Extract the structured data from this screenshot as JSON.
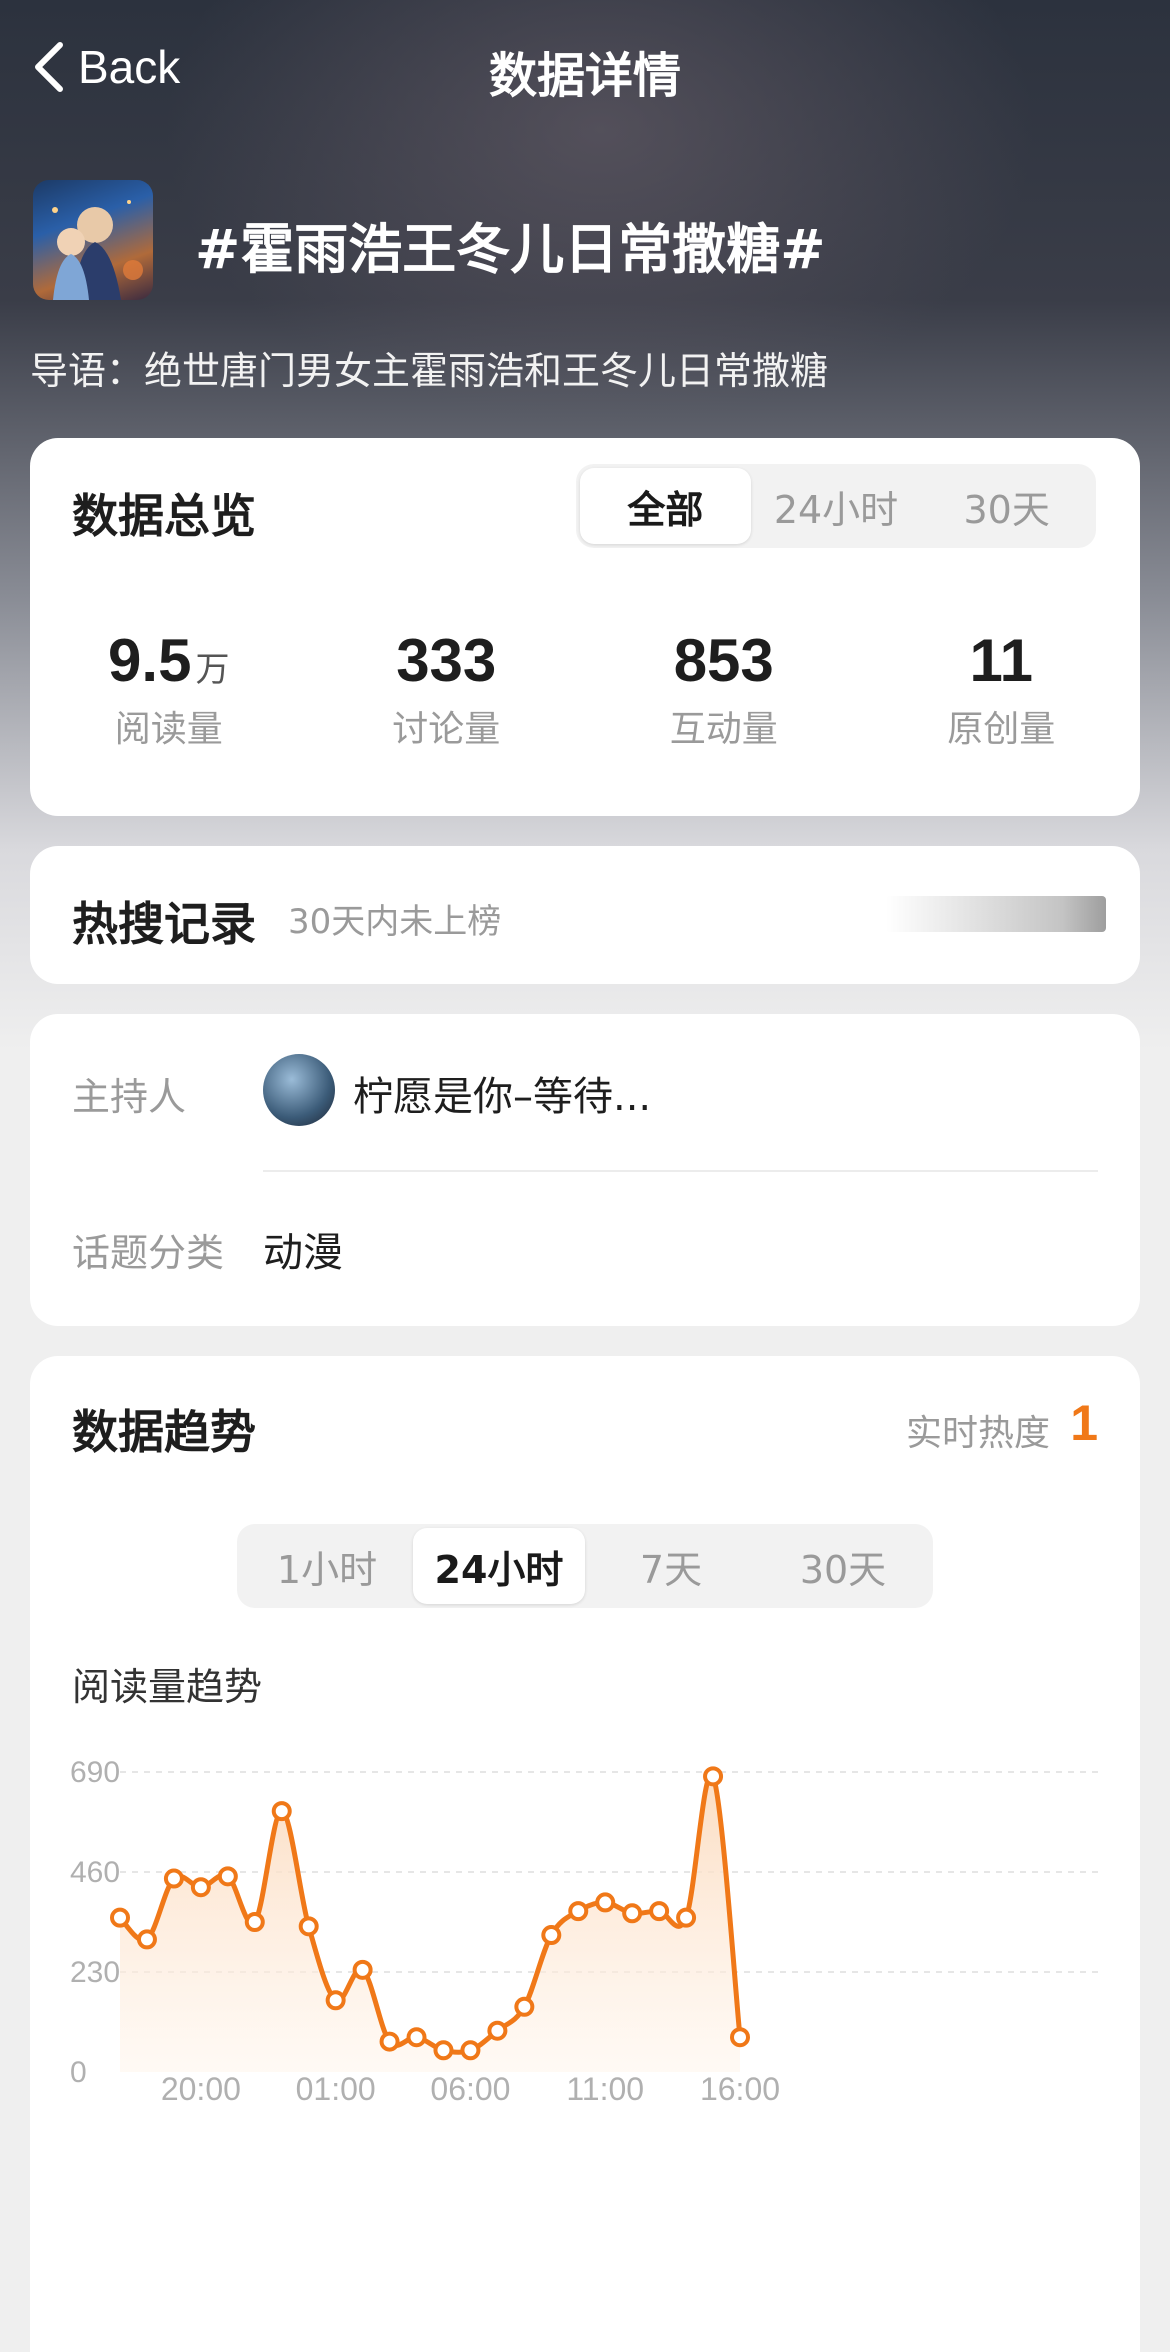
{
  "nav": {
    "back_label": "Back",
    "title": "数据详情"
  },
  "topic": {
    "title": "#霍雨浩王冬儿日常撒糖#",
    "intro": "导语：绝世唐门男女主霍雨浩和王冬儿日常撒糖"
  },
  "overview": {
    "heading": "数据总览",
    "tabs": [
      "全部",
      "24小时",
      "30天"
    ],
    "active_tab": "全部",
    "stats": [
      {
        "value": "9.5",
        "unit": "万",
        "label": "阅读量"
      },
      {
        "value": "333",
        "unit": "",
        "label": "讨论量"
      },
      {
        "value": "853",
        "unit": "",
        "label": "互动量"
      },
      {
        "value": "11",
        "unit": "",
        "label": "原创量"
      }
    ]
  },
  "hot_search": {
    "heading": "热搜记录",
    "status": "30天内未上榜"
  },
  "info": {
    "host_label": "主持人",
    "host_name": "柠愿是你–等待...",
    "category_label": "话题分类",
    "category_value": "动漫"
  },
  "trend": {
    "heading": "数据趋势",
    "heat_label": "实时热度",
    "heat_value": "1",
    "tabs": [
      "1小时",
      "24小时",
      "7天",
      "30天"
    ],
    "active_tab": "24小时",
    "chart_subtitle": "阅读量趋势"
  },
  "colors": {
    "accent": "#f07818",
    "fill_top": "#fbd9bb"
  },
  "chart_data": {
    "type": "area",
    "title": "阅读量趋势",
    "xlabel": "",
    "ylabel": "",
    "y_ticks": [
      0,
      230,
      460,
      690
    ],
    "ylim": [
      0,
      690
    ],
    "x_tick_labels": [
      "20:00",
      "01:00",
      "06:00",
      "11:00",
      "16:00"
    ],
    "x_tick_indices": [
      3,
      8,
      13,
      18,
      23
    ],
    "grid": true,
    "series": [
      {
        "values": [
          355,
          305,
          445,
          425,
          450,
          345,
          600,
          335,
          165,
          235,
          70,
          80,
          50,
          50,
          95,
          150,
          315,
          370,
          390,
          365,
          370,
          355,
          680,
          80
        ]
      }
    ]
  }
}
